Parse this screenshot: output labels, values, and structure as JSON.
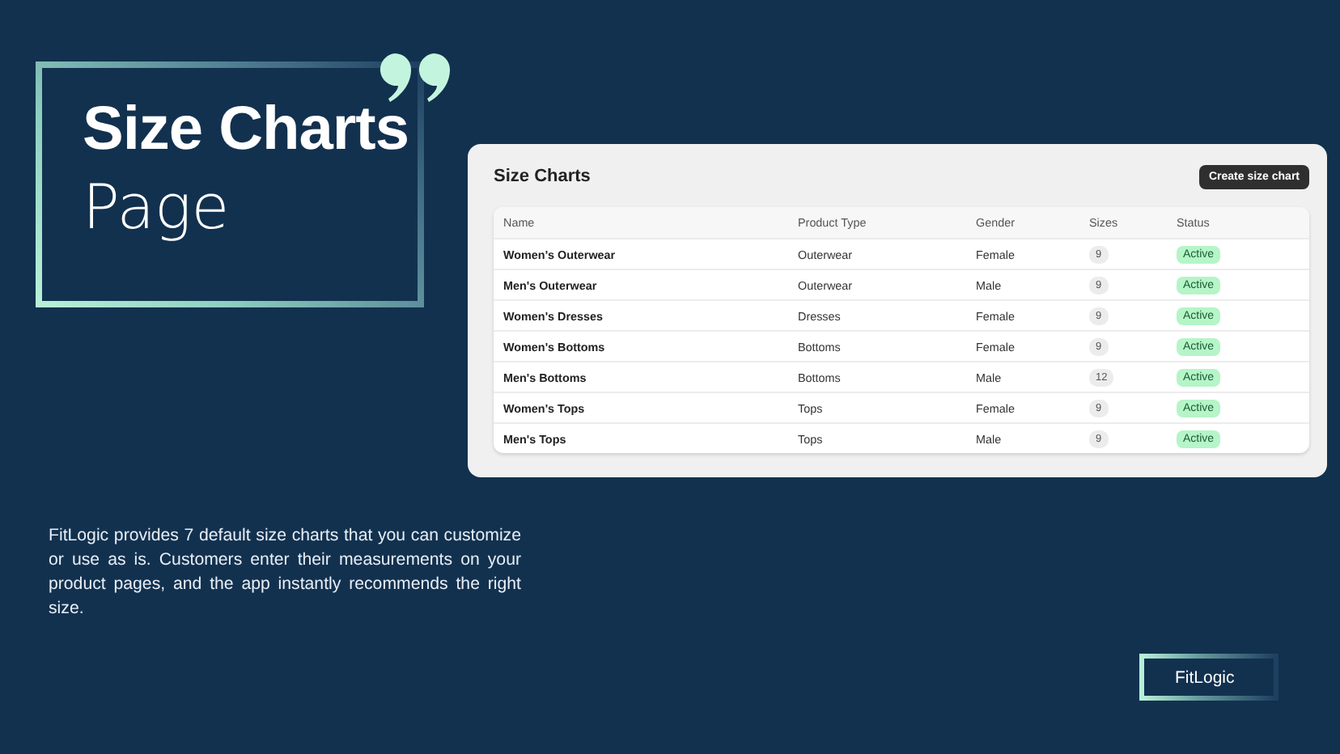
{
  "hero": {
    "title": "Size Charts",
    "subtitle": "Page"
  },
  "panel": {
    "title": "Size Charts",
    "button": "Create size chart"
  },
  "table": {
    "columns": [
      "Name",
      "Product Type",
      "Gender",
      "Sizes",
      "Status"
    ],
    "rows": [
      {
        "name": "Women's Outerwear",
        "product_type": "Outerwear",
        "gender": "Female",
        "sizes": "9",
        "status": "Active"
      },
      {
        "name": "Men's Outerwear",
        "product_type": "Outerwear",
        "gender": "Male",
        "sizes": "9",
        "status": "Active"
      },
      {
        "name": "Women's Dresses",
        "product_type": "Dresses",
        "gender": "Female",
        "sizes": "9",
        "status": "Active"
      },
      {
        "name": "Women's Bottoms",
        "product_type": "Bottoms",
        "gender": "Female",
        "sizes": "9",
        "status": "Active"
      },
      {
        "name": "Men's Bottoms",
        "product_type": "Bottoms",
        "gender": "Male",
        "sizes": "12",
        "status": "Active"
      },
      {
        "name": "Women's Tops",
        "product_type": "Tops",
        "gender": "Female",
        "sizes": "9",
        "status": "Active"
      },
      {
        "name": "Men's Tops",
        "product_type": "Tops",
        "gender": "Male",
        "sizes": "9",
        "status": "Active"
      }
    ]
  },
  "description": "FitLogic provides 7 default size charts that you can customize or use as is. Customers enter their measurements on your product pages, and the app instantly recommends the right size.",
  "brand": "FitLogic"
}
